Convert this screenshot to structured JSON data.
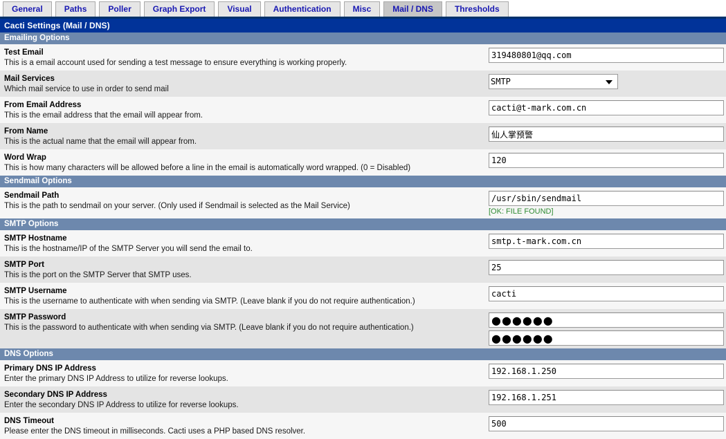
{
  "tabs": [
    {
      "label": "General",
      "active": false
    },
    {
      "label": "Paths",
      "active": false
    },
    {
      "label": "Poller",
      "active": false
    },
    {
      "label": "Graph Export",
      "active": false
    },
    {
      "label": "Visual",
      "active": false
    },
    {
      "label": "Authentication",
      "active": false
    },
    {
      "label": "Misc",
      "active": false
    },
    {
      "label": "Mail / DNS",
      "active": true
    },
    {
      "label": "Thresholds",
      "active": false
    }
  ],
  "page": {
    "title": "Cacti Settings (Mail / DNS)"
  },
  "sections": {
    "emailing": {
      "header": "Emailing Options",
      "fields": {
        "test_email": {
          "label": "Test Email",
          "description": "This is a email account used for sending a test message to ensure everything is working properly.",
          "value": "319480801@qq.com"
        },
        "mail_services": {
          "label": "Mail Services",
          "description": "Which mail service to use in order to send mail",
          "value": "SMTP",
          "options": [
            "SMTP"
          ],
          "icon": "chevron-down-icon"
        },
        "from_email": {
          "label": "From Email Address",
          "description": "This is the email address that the email will appear from.",
          "value": "cacti@t-mark.com.cn"
        },
        "from_name": {
          "label": "From Name",
          "description": "This is the actual name that the email will appear from.",
          "value": "仙人掌预警"
        },
        "word_wrap": {
          "label": "Word Wrap",
          "description": "This is how many characters will be allowed before a line in the email is automatically word wrapped. (0 = Disabled)",
          "value": "120"
        }
      }
    },
    "sendmail": {
      "header": "Sendmail Options",
      "fields": {
        "sendmail_path": {
          "label": "Sendmail Path",
          "description": "This is the path to sendmail on your server. (Only used if Sendmail is selected as the Mail Service)",
          "value": "/usr/sbin/sendmail",
          "status": "[OK: FILE FOUND]",
          "status_color": "#2f8b33"
        }
      }
    },
    "smtp": {
      "header": "SMTP Options",
      "fields": {
        "smtp_hostname": {
          "label": "SMTP Hostname",
          "description": "This is the hostname/IP of the SMTP Server you will send the email to.",
          "value": "smtp.t-mark.com.cn"
        },
        "smtp_port": {
          "label": "SMTP Port",
          "description": "This is the port on the SMTP Server that SMTP uses.",
          "value": "25"
        },
        "smtp_username": {
          "label": "SMTP Username",
          "description": "This is the username to authenticate with when sending via SMTP. (Leave blank if you do not require authentication.)",
          "value": "cacti"
        },
        "smtp_password": {
          "label": "SMTP Password",
          "description": "This is the password to authenticate with when sending via SMTP. (Leave blank if you do not require authentication.)",
          "value": "●●●●●●",
          "value_confirm": "●●●●●●"
        }
      }
    },
    "dns": {
      "header": "DNS Options",
      "fields": {
        "primary_dns": {
          "label": "Primary DNS IP Address",
          "description": "Enter the primary DNS IP Address to utilize for reverse lookups.",
          "value": "192.168.1.250"
        },
        "secondary_dns": {
          "label": "Secondary DNS IP Address",
          "description": "Enter the secondary DNS IP Address to utilize for reverse lookups.",
          "value": "192.168.1.251"
        },
        "dns_timeout": {
          "label": "DNS Timeout",
          "description": "Please enter the DNS timeout in milliseconds. Cacti uses a PHP based DNS resolver.",
          "value": "500"
        }
      }
    }
  },
  "colors": {
    "title_bar": "#013399",
    "section_header": "#6d88ad",
    "tab_text": "#1818b2",
    "tab_active_bg": "#c6c6c6",
    "status_ok": "#2f8b33"
  }
}
